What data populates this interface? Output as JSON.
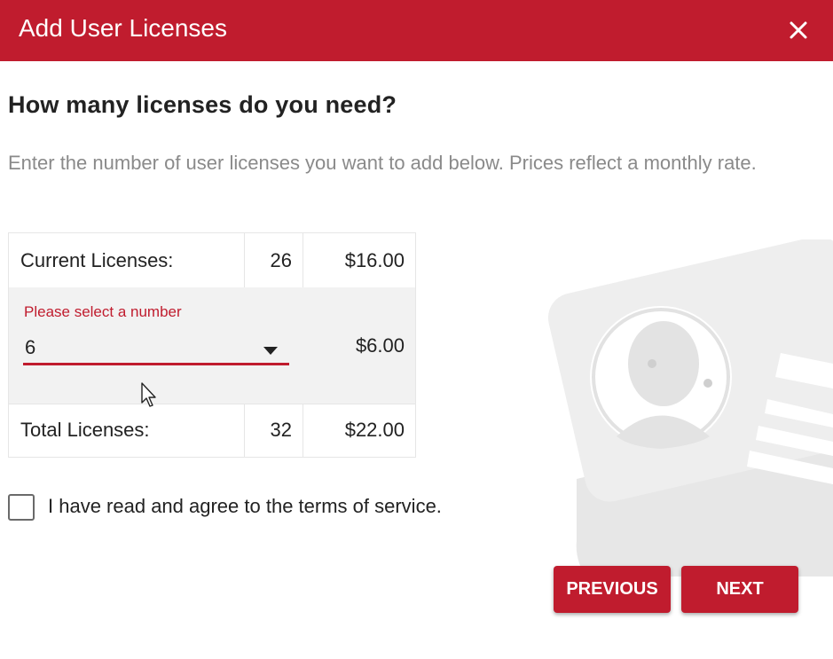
{
  "dialog": {
    "title": "Add User Licenses",
    "close_icon": "close-icon"
  },
  "heading": "How many licenses do you need?",
  "description": "Enter the number of user licenses you want to add below. Prices reflect a monthly rate.",
  "license_table": {
    "current": {
      "label": "Current Licenses:",
      "count": "26",
      "price": "$16.00"
    },
    "add": {
      "select_label": "Please select a number",
      "selected_value": "6",
      "price": "$6.00"
    },
    "total": {
      "label": "Total Licenses:",
      "count": "32",
      "price": "$22.00"
    }
  },
  "terms": {
    "label": "I have read and agree to the terms of service.",
    "checked": false
  },
  "buttons": {
    "previous": "PREVIOUS",
    "next": "NEXT"
  },
  "colors": {
    "brand": "#c01c2e",
    "illustration": "#eeeeee"
  }
}
